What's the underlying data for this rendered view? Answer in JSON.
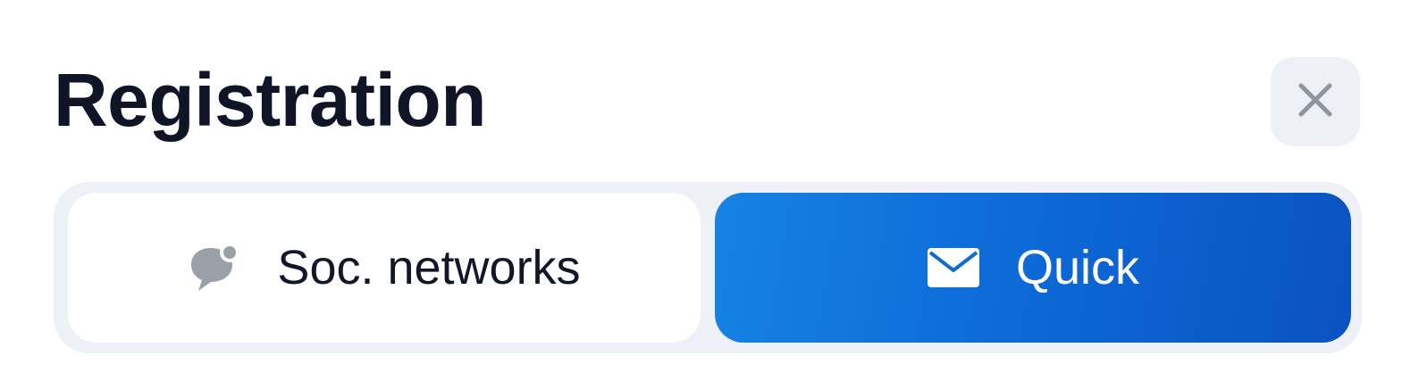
{
  "dialog": {
    "title": "Registration",
    "close_icon": "close-icon"
  },
  "tabs": [
    {
      "label": "Soc. networks",
      "icon": "chat-bubble-icon",
      "selected": false
    },
    {
      "label": "Quick",
      "icon": "envelope-icon",
      "selected": true
    }
  ],
  "colors": {
    "title": "#0f1426",
    "segment_bg": "#edf0f6",
    "selected_gradient_start": "#1683e4",
    "selected_gradient_end": "#0a52c2",
    "icon_gray": "#9aa0a8"
  }
}
